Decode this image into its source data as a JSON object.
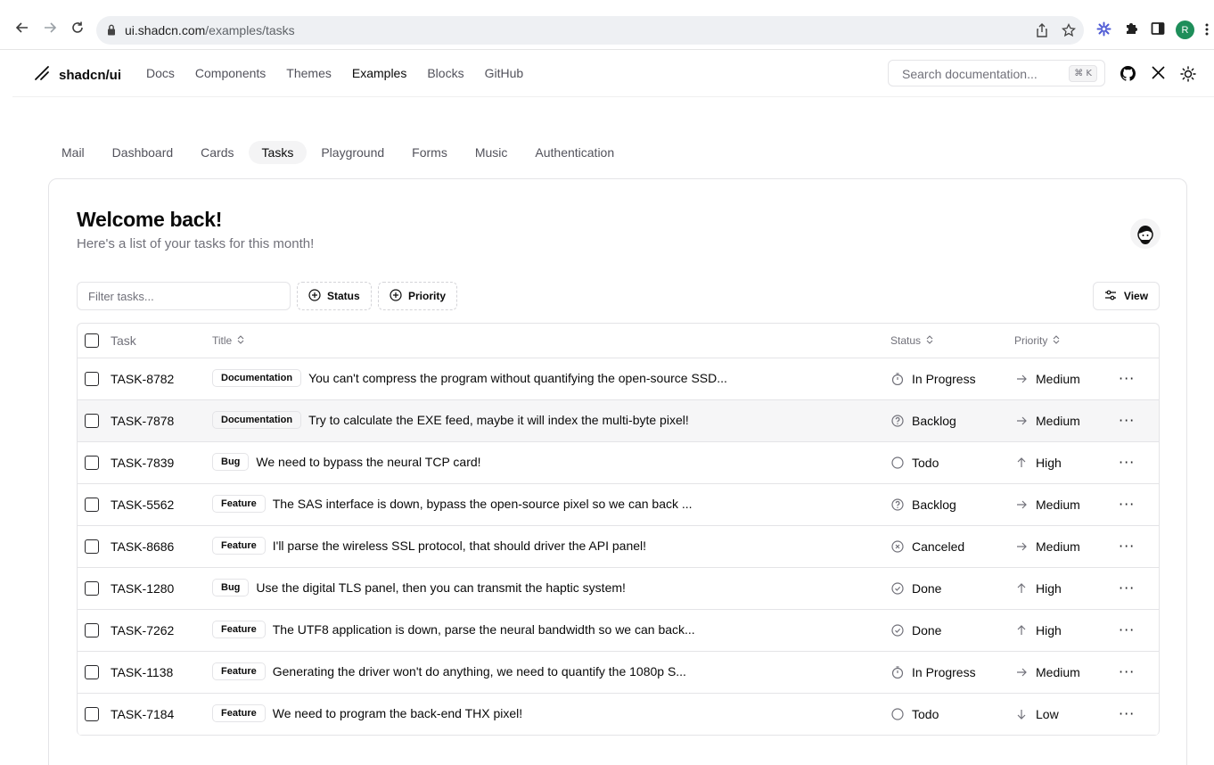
{
  "browser": {
    "url_host": "ui.shadcn.com",
    "url_path": "/examples/tasks",
    "profile_initial": "R"
  },
  "site": {
    "logo_text": "shadcn/ui",
    "nav": [
      "Docs",
      "Components",
      "Themes",
      "Examples",
      "Blocks",
      "GitHub"
    ],
    "active_nav": "Examples",
    "search_placeholder": "Search documentation...",
    "search_shortcut": "⌘ K"
  },
  "example_tabs": [
    "Mail",
    "Dashboard",
    "Cards",
    "Tasks",
    "Playground",
    "Forms",
    "Music",
    "Authentication"
  ],
  "active_example_tab": "Tasks",
  "page": {
    "heading": "Welcome back!",
    "subtitle": "Here's a list of your tasks for this month!"
  },
  "toolbar": {
    "filter_placeholder": "Filter tasks...",
    "status_filter": "Status",
    "priority_filter": "Priority",
    "view_button": "View"
  },
  "table": {
    "headers": {
      "task": "Task",
      "title": "Title",
      "status": "Status",
      "priority": "Priority"
    },
    "rows": [
      {
        "id": "TASK-8782",
        "label": "Documentation",
        "title": "You can't compress the program without quantifying the open-source SSD...",
        "status": "In Progress",
        "status_icon": "timer-icon",
        "priority": "Medium",
        "priority_icon": "arrow-right-icon"
      },
      {
        "id": "TASK-7878",
        "label": "Documentation",
        "title": "Try to calculate the EXE feed, maybe it will index the multi-byte pixel!",
        "status": "Backlog",
        "status_icon": "help-circle-icon",
        "priority": "Medium",
        "priority_icon": "arrow-right-icon"
      },
      {
        "id": "TASK-7839",
        "label": "Bug",
        "title": "We need to bypass the neural TCP card!",
        "status": "Todo",
        "status_icon": "circle-icon",
        "priority": "High",
        "priority_icon": "arrow-up-icon"
      },
      {
        "id": "TASK-5562",
        "label": "Feature",
        "title": "The SAS interface is down, bypass the open-source pixel so we can back ...",
        "status": "Backlog",
        "status_icon": "help-circle-icon",
        "priority": "Medium",
        "priority_icon": "arrow-right-icon"
      },
      {
        "id": "TASK-8686",
        "label": "Feature",
        "title": "I'll parse the wireless SSL protocol, that should driver the API panel!",
        "status": "Canceled",
        "status_icon": "x-circle-icon",
        "priority": "Medium",
        "priority_icon": "arrow-right-icon"
      },
      {
        "id": "TASK-1280",
        "label": "Bug",
        "title": "Use the digital TLS panel, then you can transmit the haptic system!",
        "status": "Done",
        "status_icon": "check-circle-icon",
        "priority": "High",
        "priority_icon": "arrow-up-icon"
      },
      {
        "id": "TASK-7262",
        "label": "Feature",
        "title": "The UTF8 application is down, parse the neural bandwidth so we can back...",
        "status": "Done",
        "status_icon": "check-circle-icon",
        "priority": "High",
        "priority_icon": "arrow-up-icon"
      },
      {
        "id": "TASK-1138",
        "label": "Feature",
        "title": "Generating the driver won't do anything, we need to quantify the 1080p S...",
        "status": "In Progress",
        "status_icon": "timer-icon",
        "priority": "Medium",
        "priority_icon": "arrow-right-icon"
      },
      {
        "id": "TASK-7184",
        "label": "Feature",
        "title": "We need to program the back-end THX pixel!",
        "status": "Todo",
        "status_icon": "circle-icon",
        "priority": "Low",
        "priority_icon": "arrow-down-icon"
      }
    ],
    "hover_row_index": 1
  }
}
